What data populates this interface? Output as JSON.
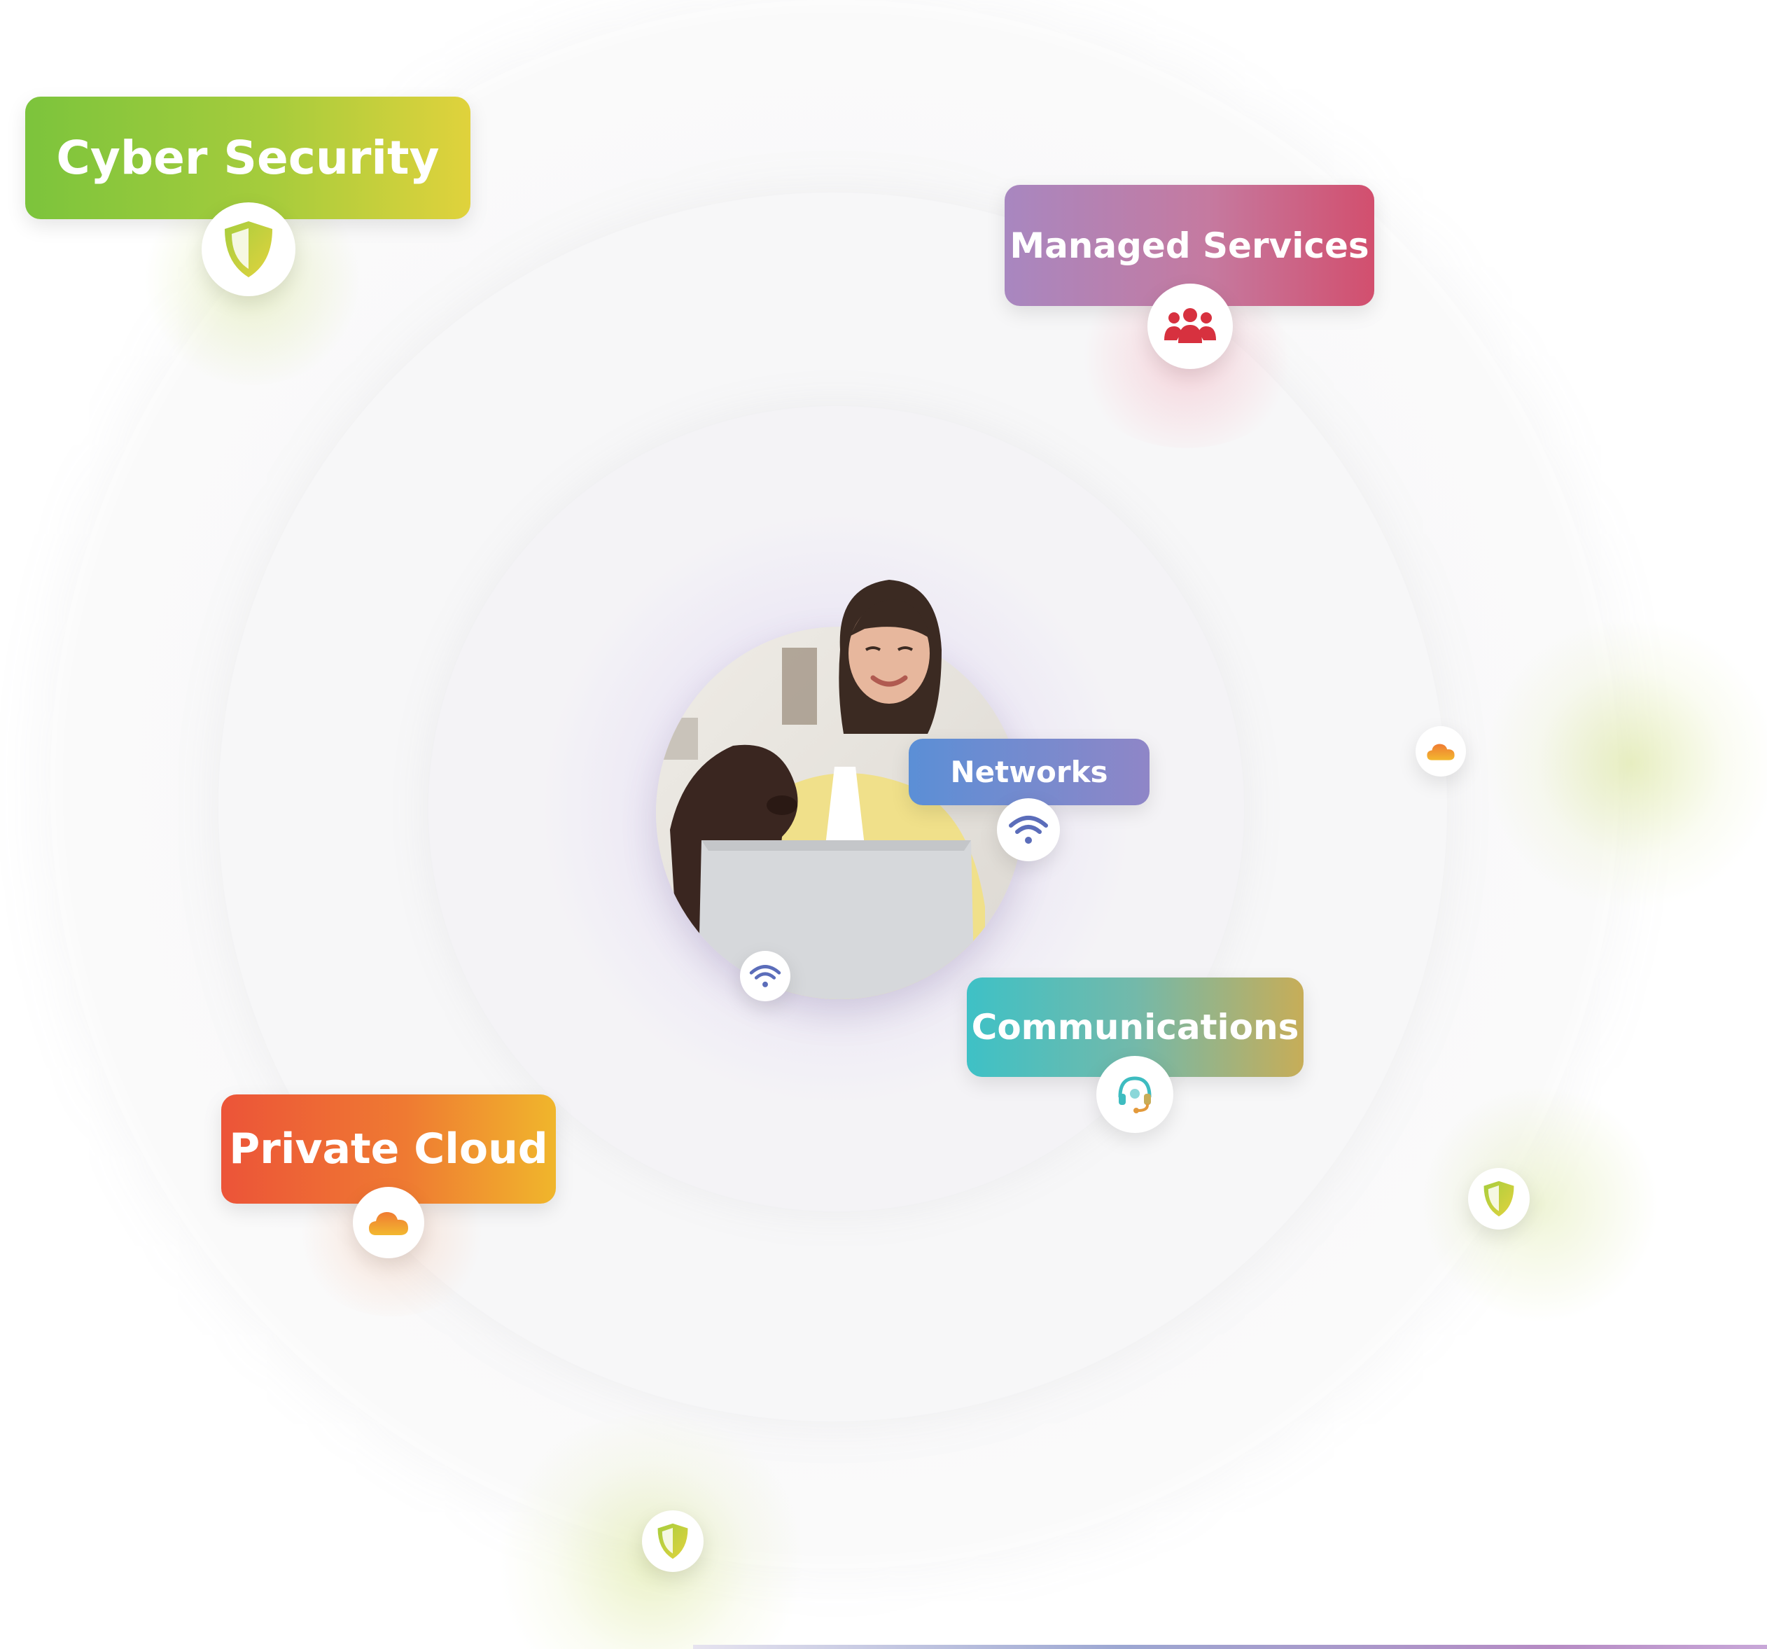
{
  "labels": {
    "cyber_security": "Cyber Security",
    "managed_services": "Managed Services",
    "networks": "Networks",
    "communications": "Communications",
    "private_cloud": "Private Cloud"
  },
  "icons": {
    "cyber_security": "shield-icon",
    "managed_services": "team-icon",
    "networks": "wifi-icon",
    "communications": "headset-icon",
    "private_cloud": "cloud-icon"
  },
  "colors": {
    "cyber_security": [
      "#7cc43c",
      "#e0d23c"
    ],
    "managed_services": [
      "#a887c0",
      "#d24f6e"
    ],
    "networks": [
      "#5b8fd6",
      "#8f86c7"
    ],
    "communications": [
      "#3ec1c6",
      "#c7ad58"
    ],
    "private_cloud": [
      "#ec5438",
      "#f0b62c"
    ]
  }
}
